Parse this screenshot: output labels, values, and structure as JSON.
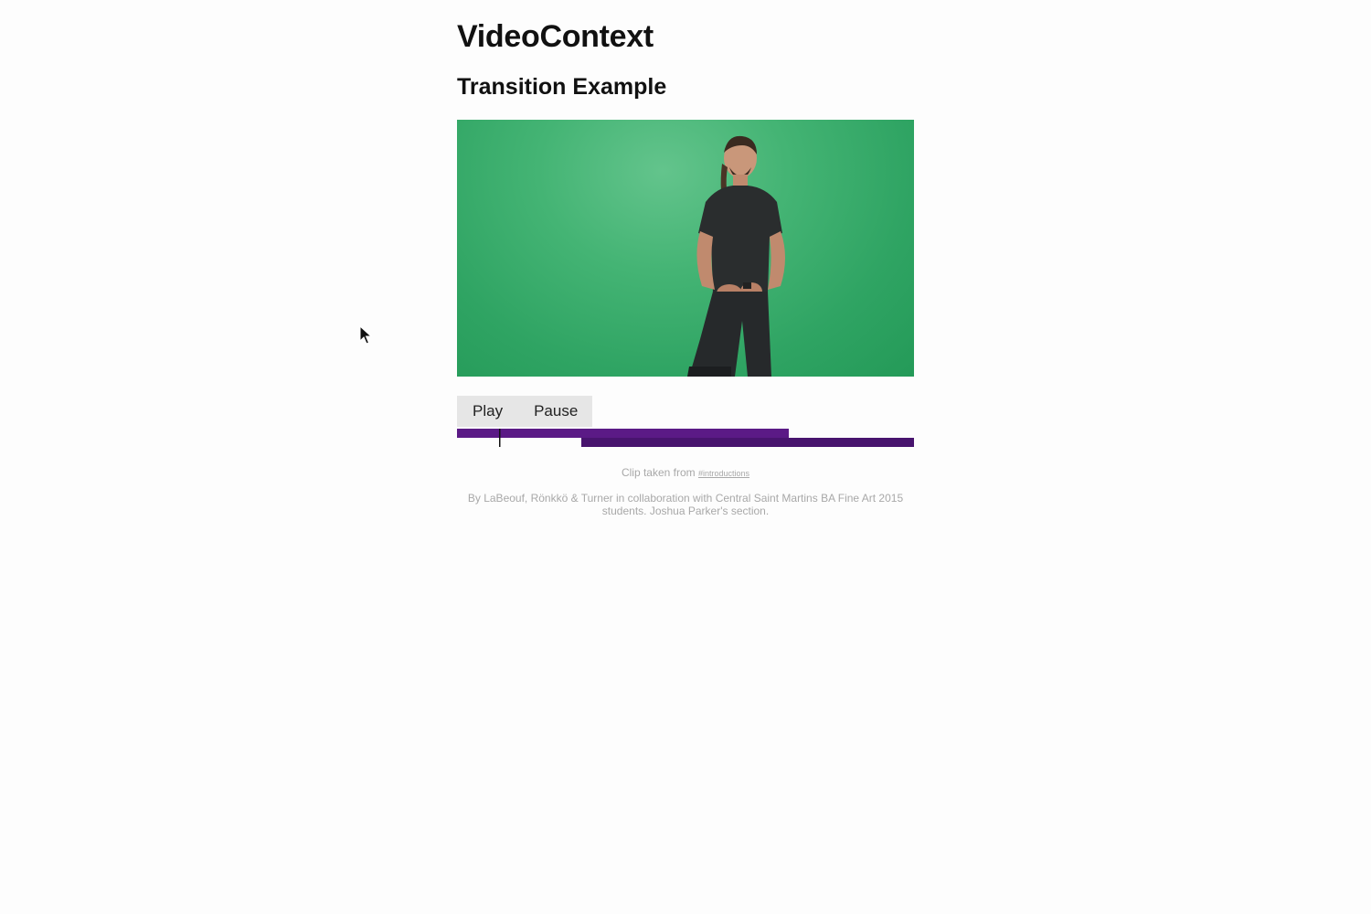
{
  "header": {
    "title": "VideoContext",
    "subtitle": "Transition Example"
  },
  "controls": {
    "play_label": "Play",
    "pause_label": "Pause"
  },
  "timeline": {
    "colors": {
      "track_a": "#5b1a86",
      "track_b": "#48146e",
      "playhead": "#111111"
    },
    "playhead_fraction": 0.092
  },
  "caption": {
    "prefix": "Clip taken from ",
    "link_text": "#introductions"
  },
  "credit": {
    "text": "By LaBeouf, Rönkkö & Turner in collaboration with Central Saint Martins BA Fine Art 2015 students. Joshua Parker's section."
  },
  "icons": {
    "cursor": "arrow-cursor-icon"
  },
  "colors": {
    "background": "#fdfdfd",
    "green_screen": "#3aae6b",
    "controls_bg": "#e6e6e6"
  }
}
